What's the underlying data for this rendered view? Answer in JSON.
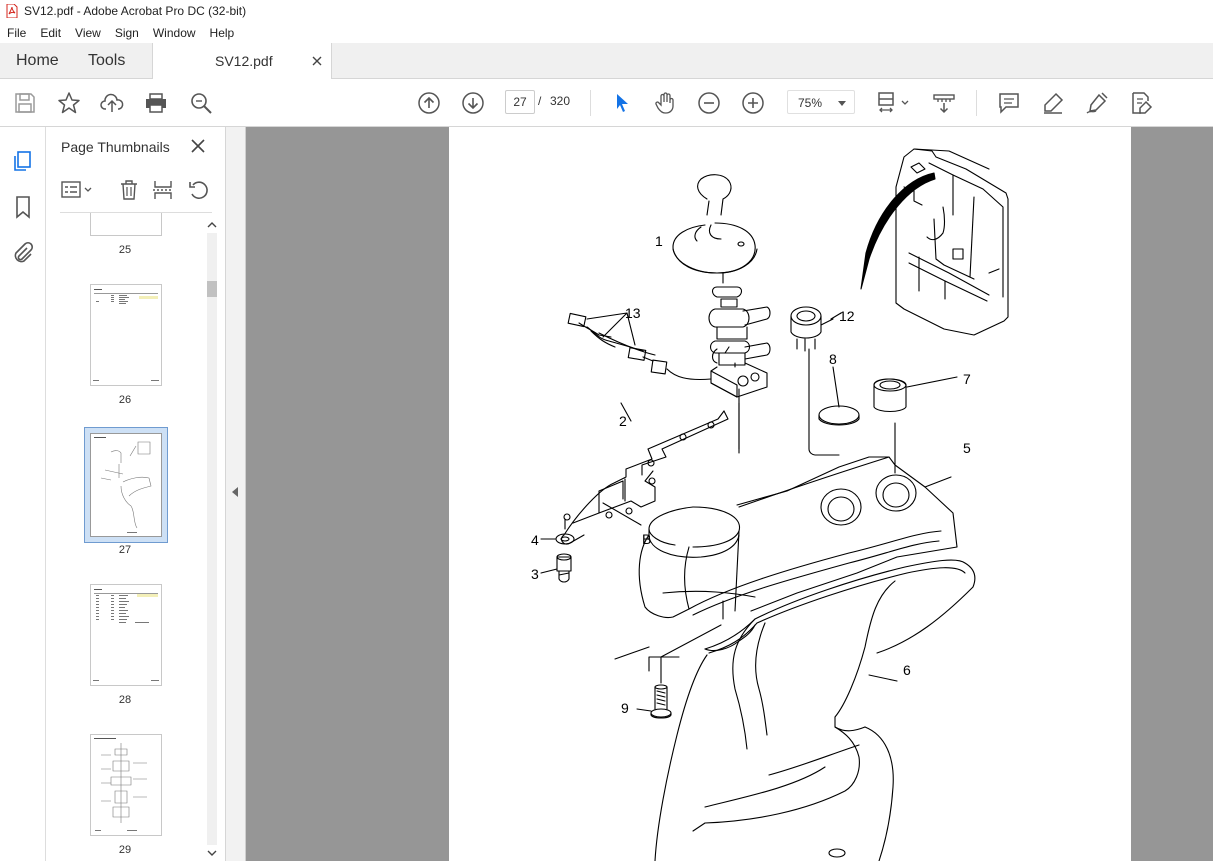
{
  "window": {
    "title": "SV12.pdf - Adobe Acrobat Pro DC (32-bit)"
  },
  "menu": [
    "File",
    "Edit",
    "View",
    "Sign",
    "Window",
    "Help"
  ],
  "tabs": {
    "home": "Home",
    "tools": "Tools",
    "document": "SV12.pdf"
  },
  "toolbar": {
    "page_current": "27",
    "page_separator": "/",
    "page_total": "320",
    "zoom": "75%"
  },
  "panel": {
    "title": "Page Thumbnails",
    "thumbnails": [
      {
        "label": "25"
      },
      {
        "label": "26"
      },
      {
        "label": "27",
        "selected": true
      },
      {
        "label": "28"
      },
      {
        "label": "29"
      }
    ]
  },
  "diagram": {
    "callouts": [
      "1",
      "13",
      "12",
      "8",
      "7",
      "2",
      "5",
      "4",
      "B",
      "3",
      "6",
      "9"
    ]
  },
  "colors": {
    "accent": "#1473e6",
    "doc_bg": "#969696",
    "selected_thumb": "#cde0f5"
  }
}
